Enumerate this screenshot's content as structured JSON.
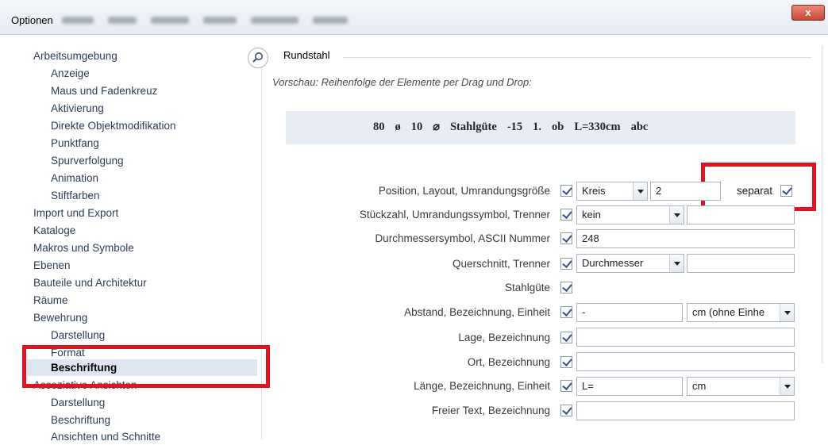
{
  "window": {
    "title": "Optionen",
    "close_label": "x"
  },
  "tree": {
    "items": [
      {
        "label": "Arbeitsumgebung",
        "level": 1
      },
      {
        "label": "Anzeige",
        "level": 2
      },
      {
        "label": "Maus und Fadenkreuz",
        "level": 2
      },
      {
        "label": "Aktivierung",
        "level": 2
      },
      {
        "label": "Direkte Objektmodifikation",
        "level": 2
      },
      {
        "label": "Punktfang",
        "level": 2
      },
      {
        "label": "Spurverfolgung",
        "level": 2
      },
      {
        "label": "Animation",
        "level": 2
      },
      {
        "label": "Stiftfarben",
        "level": 2
      },
      {
        "label": "Import und Export",
        "level": 1
      },
      {
        "label": "Kataloge",
        "level": 1
      },
      {
        "label": "Makros und Symbole",
        "level": 1
      },
      {
        "label": "Ebenen",
        "level": 1
      },
      {
        "label": "Bauteile und Architektur",
        "level": 1
      },
      {
        "label": "Räume",
        "level": 1
      },
      {
        "label": "Bewehrung",
        "level": 1
      },
      {
        "label": "Darstellung",
        "level": 2
      },
      {
        "label": "Format",
        "level": 2
      },
      {
        "label": "Beschriftung",
        "level": 2,
        "selected": true
      },
      {
        "label": "Assoziative Ansichten",
        "level": 1
      },
      {
        "label": "Darstellung",
        "level": 2
      },
      {
        "label": "Beschriftung",
        "level": 2
      },
      {
        "label": "Ansichten und Schnitte",
        "level": 2
      }
    ]
  },
  "panel": {
    "section_title": "Rundstahl",
    "preview_caption": "Vorschau: Reihenfolge der Elemente per Drag und Drop:",
    "preview_items": [
      "80",
      "ø",
      "10",
      "⌀",
      "Stahlgüte",
      "-15",
      "1.",
      "ob",
      "L=330cm",
      "abc"
    ],
    "rows": {
      "position": {
        "label": "Position, Layout, Umrandungsgröße",
        "combo": "Kreis",
        "value": "2",
        "separat_label": "separat"
      },
      "stueckzahl": {
        "label": "Stückzahl, Umrandungssymbol, Trenner",
        "combo": "kein",
        "value": ""
      },
      "durchmesser": {
        "label": "Durchmessersymbol, ASCII Nummer",
        "value": "248"
      },
      "querschnitt": {
        "label": "Querschnitt, Trenner",
        "combo": "Durchmesser",
        "value": ""
      },
      "stahlguete": {
        "label": "Stahlgüte"
      },
      "abstand": {
        "label": "Abstand, Bezeichnung, Einheit",
        "value": "-",
        "combo": "cm (ohne Einhe"
      },
      "lage": {
        "label": "Lage, Bezeichnung",
        "value": ""
      },
      "ort": {
        "label": "Ort, Bezeichnung",
        "value": ""
      },
      "laenge": {
        "label": "Länge, Bezeichnung, Einheit",
        "value": "L=",
        "combo": "cm"
      },
      "freitext": {
        "label": "Freier Text, Bezeichnung",
        "value": ""
      }
    }
  },
  "colors": {
    "highlight_box": "#e0141e",
    "selection_bg": "#dde6f1",
    "preview_bg": "#e8edf3"
  }
}
